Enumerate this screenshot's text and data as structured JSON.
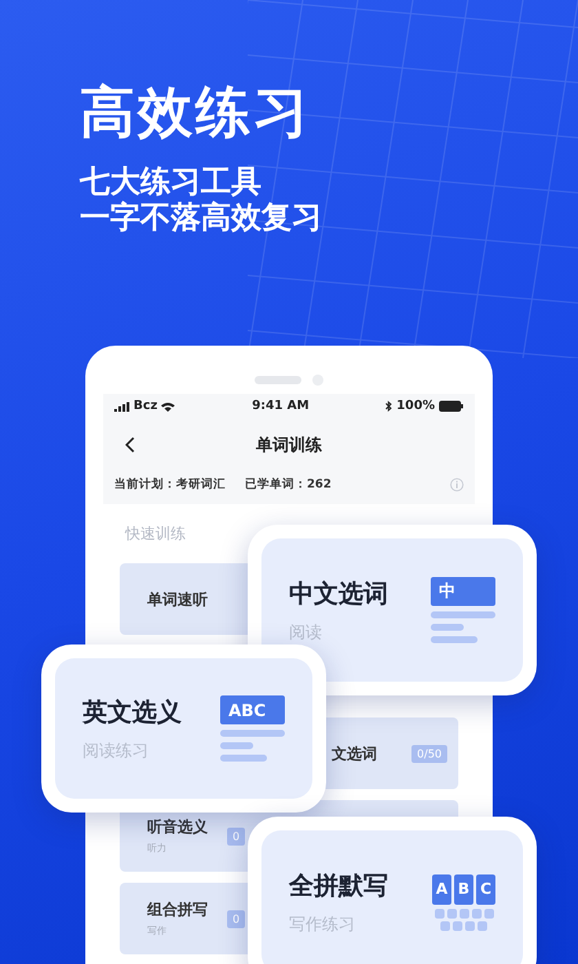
{
  "headline": "高效练习",
  "subtitle": [
    "七大练习工具",
    "一字不落高效复习"
  ],
  "phone": {
    "status_bar": {
      "carrier": "Bcz",
      "time": "9:41 AM",
      "battery": "100%"
    },
    "nav_title": "单词训练",
    "plan": {
      "current": "当前计划：考研词汇",
      "learned": "已学单词：262"
    },
    "section": "快速训练",
    "items": [
      {
        "title": "单词速听"
      },
      {
        "title": "文选词",
        "badge": "0/50"
      },
      {
        "title": "听音选义",
        "subtitle": "听力",
        "badge": "0"
      },
      {
        "title": "组合拼写",
        "subtitle": "写作",
        "badge": "0"
      }
    ]
  },
  "cards": [
    {
      "title": "中文选词",
      "subtitle": "阅读",
      "icon": {
        "kind": "label",
        "text": "中"
      }
    },
    {
      "title": "英文选义",
      "subtitle": "阅读练习",
      "icon": {
        "kind": "label",
        "text": "ABC"
      }
    },
    {
      "title": "全拼默写",
      "subtitle": "写作练习",
      "icon": {
        "kind": "keys",
        "keys": [
          "A",
          "B",
          "C"
        ]
      }
    }
  ]
}
